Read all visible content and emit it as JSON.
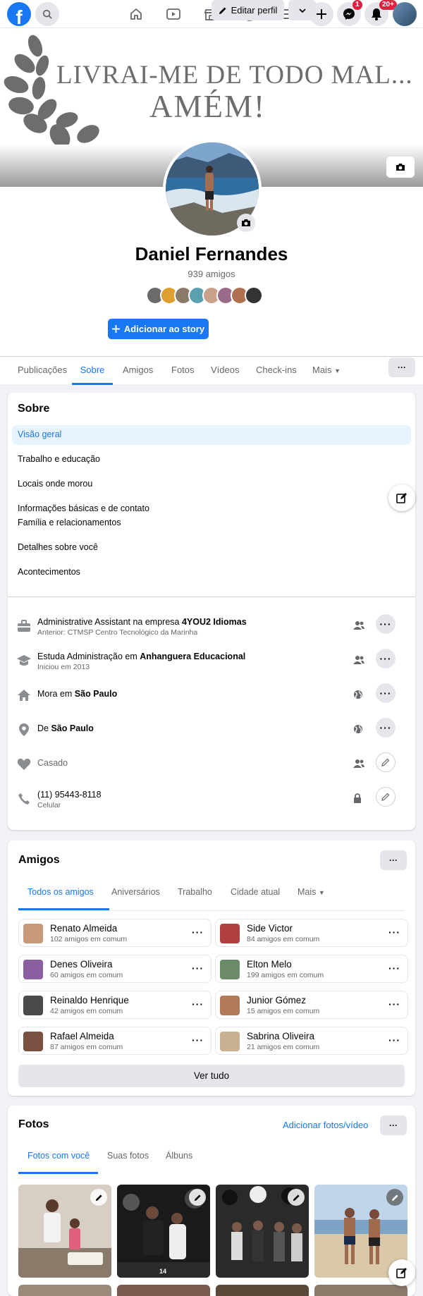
{
  "nav": {
    "logo": "f",
    "messenger_badge": "1",
    "notifications_badge": "20+"
  },
  "cover": {
    "line1": "LIVRAI-ME DE TODO MAL...",
    "line2": "AMÉM!"
  },
  "profile": {
    "name": "Daniel Fernandes",
    "friends_count": "939 amigos",
    "add_story": "Adicionar ao story",
    "edit_profile": "Editar perfil"
  },
  "tabs": [
    "Publicações",
    "Sobre",
    "Amigos",
    "Fotos",
    "Vídeos",
    "Check-ins",
    "Mais"
  ],
  "about": {
    "title": "Sobre",
    "items": [
      "Visão geral",
      "Trabalho e educação",
      "Locais onde morou",
      "Informações básicas e de contato",
      "Família e relacionamentos",
      "Detalhes sobre você",
      "Acontecimentos"
    ],
    "rows": [
      {
        "pre": "Administrative Assistant na empresa ",
        "bold": "4YOU2 Idiomas",
        "sub": "Anterior: CTMSP Centro Tecnológico da Marinha"
      },
      {
        "pre": "Estuda Administração em ",
        "bold": "Anhanguera Educacional",
        "sub": "Iniciou em 2013"
      },
      {
        "pre": "Mora em ",
        "bold": "São Paulo",
        "sub": ""
      },
      {
        "pre": "De ",
        "bold": "São Paulo",
        "sub": ""
      },
      {
        "pre": "Casado",
        "bold": "",
        "sub": ""
      },
      {
        "pre": "(11) 95443-8118",
        "bold": "",
        "sub": "Celular"
      }
    ]
  },
  "friends": {
    "title": "Amigos",
    "tabs": [
      "Todos os amigos",
      "Aniversários",
      "Trabalho",
      "Cidade atual",
      "Mais"
    ],
    "list": [
      {
        "name": "Renato Almeida",
        "mutual": "102 amigos em comum"
      },
      {
        "name": "Side Victor",
        "mutual": "84 amigos em comum"
      },
      {
        "name": "Denes Oliveira",
        "mutual": "60 amigos em comum"
      },
      {
        "name": "Elton Melo",
        "mutual": "199 amigos em comum"
      },
      {
        "name": "Reinaldo Henrique",
        "mutual": "42 amigos em comum"
      },
      {
        "name": "Junior Gómez",
        "mutual": "15 amigos em comum"
      },
      {
        "name": "Rafael Almeida",
        "mutual": "87 amigos em comum"
      },
      {
        "name": "Sabrina Oliveira",
        "mutual": "21 amigos em comum"
      }
    ],
    "see_all": "Ver tudo"
  },
  "photos": {
    "title": "Fotos",
    "add": "Adicionar fotos/vídeo",
    "tabs": [
      "Fotos com você",
      "Suas fotos",
      "Álbuns"
    ],
    "photo_caption": "14"
  },
  "colors": {
    "brand": "#1877f2",
    "badge": "#e41e3f"
  }
}
